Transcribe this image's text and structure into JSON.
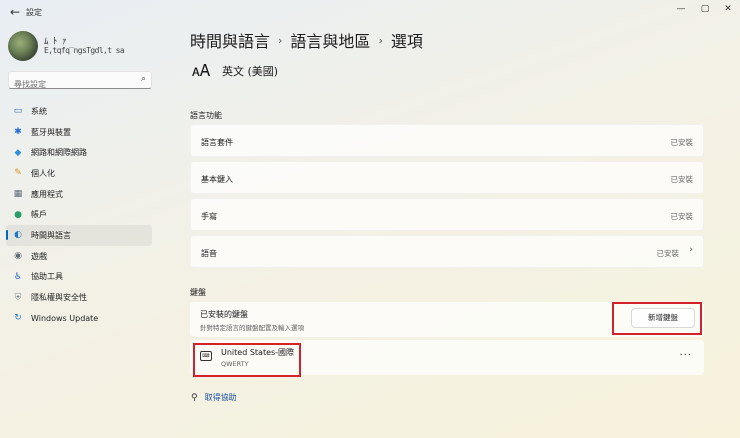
{
  "window": {
    "title": "設定",
    "back_icon": "←",
    "minimize": "—",
    "maximize": "▢",
    "close": "✕"
  },
  "profile": {
    "name": "ﾑ ﾄ ｧ",
    "email": "E,tqfq‾ngsTgdl,t sa"
  },
  "search": {
    "placeholder": "尋找設定",
    "icon": "⌕"
  },
  "sidebar": {
    "items": [
      {
        "label": "系統",
        "icon": "▭",
        "icon_color": "#2b6cb0"
      },
      {
        "label": "藍牙與裝置",
        "icon": "✱",
        "icon_color": "#1f6fd6"
      },
      {
        "label": "網路和網際網路",
        "icon": "◆",
        "icon_color": "#2f8fd8"
      },
      {
        "label": "個人化",
        "icon": "✎",
        "icon_color": "#d98c1c"
      },
      {
        "label": "應用程式",
        "icon": "▦",
        "icon_color": "#5a6b7c"
      },
      {
        "label": "帳戶",
        "icon": "●",
        "icon_color": "#2a9d6a"
      },
      {
        "label": "時間與語言",
        "icon": "◐",
        "icon_color": "#1f78c8"
      },
      {
        "label": "遊戲",
        "icon": "◉",
        "icon_color": "#5c6b7a"
      },
      {
        "label": "協助工具",
        "icon": "♿",
        "icon_color": "#2466c2"
      },
      {
        "label": "隱私權與安全性",
        "icon": "⛨",
        "icon_color": "#7a8794"
      },
      {
        "label": "Windows Update",
        "icon": "↻",
        "icon_color": "#1f78c8"
      }
    ],
    "active_index": 6
  },
  "breadcrumb": {
    "level1": "時間與語言",
    "level2": "語言與地區",
    "current": "選項",
    "separator": "›"
  },
  "language": {
    "icon": "🗚",
    "name": "英文 (美國)"
  },
  "language_features": {
    "section_label": "語言功能",
    "items": [
      {
        "label": "語言套件",
        "status": "已安裝"
      },
      {
        "label": "基本鍵入",
        "status": "已安裝"
      },
      {
        "label": "手寫",
        "status": "已安裝"
      },
      {
        "label": "語音",
        "status": "已安裝"
      }
    ],
    "chevron": "›"
  },
  "keyboard": {
    "section_label": "鍵盤",
    "installed_title": "已安裝的鍵盤",
    "installed_desc": "針對特定語言的鍵盤配置及輸入選項",
    "add_button": "新增鍵盤",
    "items": [
      {
        "name": "United States-國際",
        "layout": "QWERTY",
        "more": "···"
      }
    ]
  },
  "help": {
    "icon": "⚲",
    "label": "取得協助"
  },
  "colors": {
    "accent": "#0067c0",
    "highlight": "#d3222a",
    "link": "#1b4f9c"
  }
}
